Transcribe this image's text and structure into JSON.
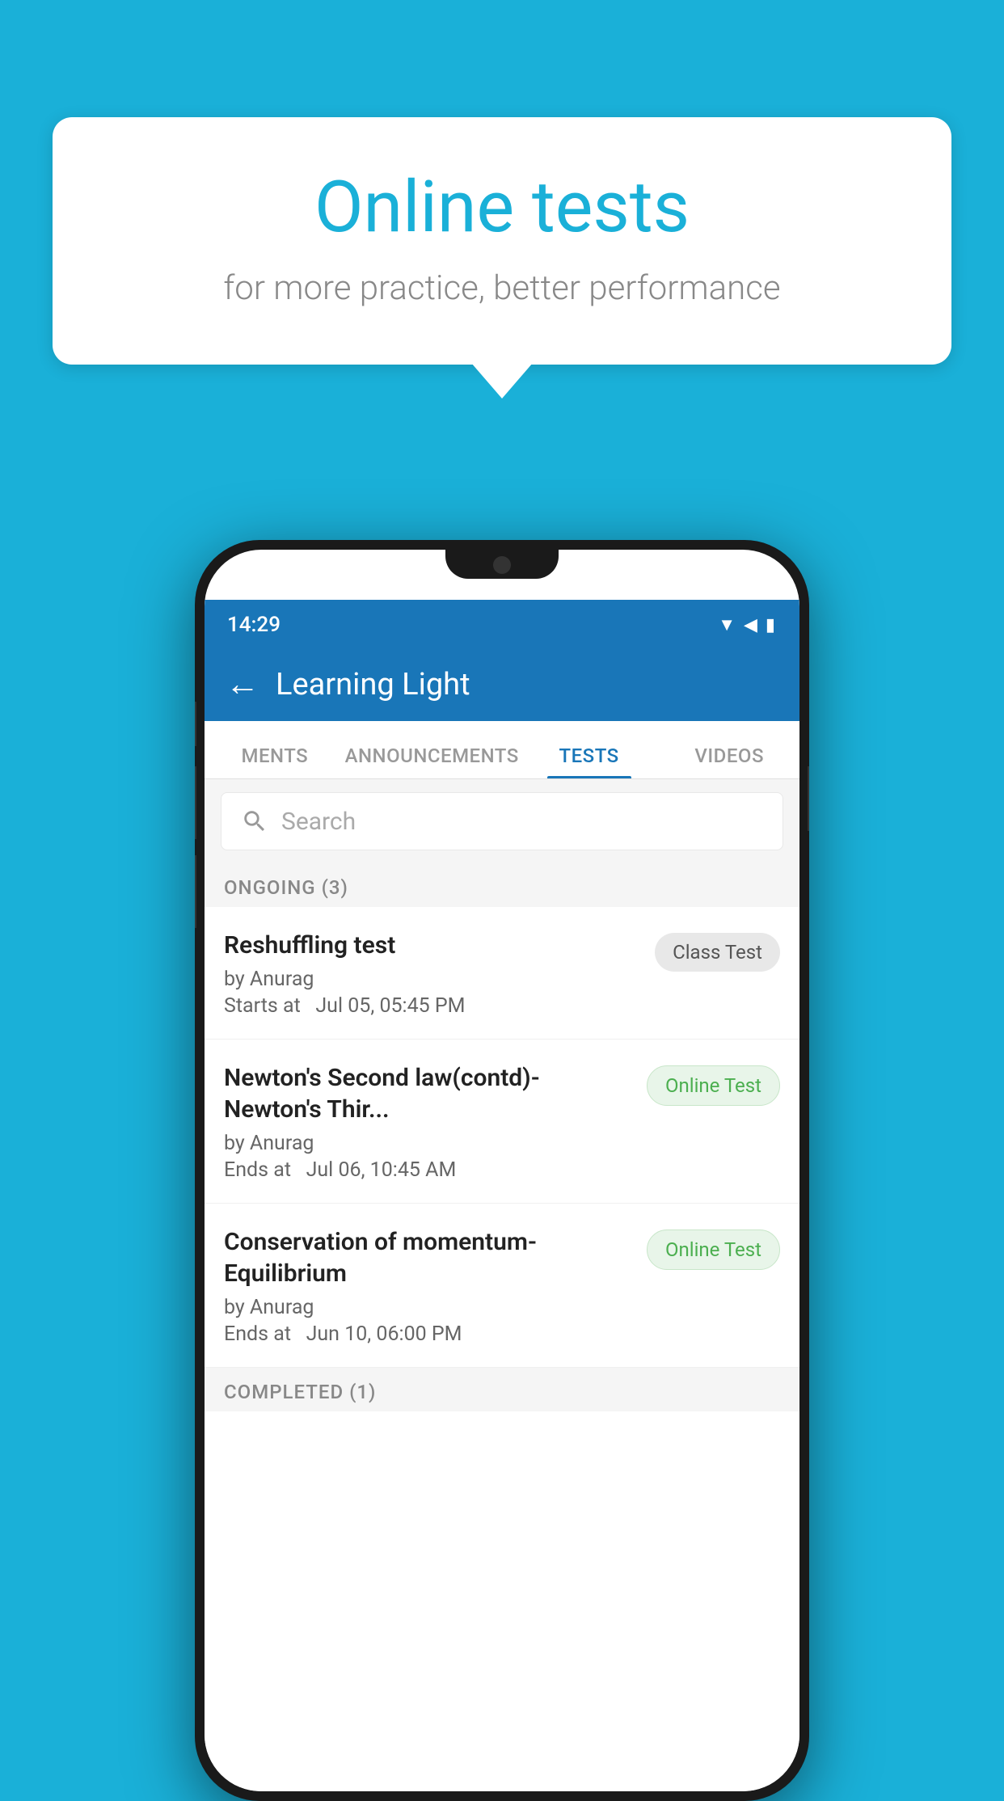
{
  "background": {
    "color": "#1ab0d8"
  },
  "speech_bubble": {
    "title": "Online tests",
    "subtitle": "for more practice, better performance"
  },
  "phone": {
    "status_bar": {
      "time": "14:29",
      "icons": [
        "wifi",
        "signal",
        "battery"
      ]
    },
    "header": {
      "back_label": "←",
      "title": "Learning Light"
    },
    "tabs": [
      {
        "label": "MENTS",
        "active": false
      },
      {
        "label": "ANNOUNCEMENTS",
        "active": false
      },
      {
        "label": "TESTS",
        "active": true
      },
      {
        "label": "VIDEOS",
        "active": false
      }
    ],
    "search": {
      "placeholder": "Search"
    },
    "sections": [
      {
        "header": "ONGOING (3)",
        "items": [
          {
            "name": "Reshuffling test",
            "author": "by Anurag",
            "time_label": "Starts at",
            "time": "Jul 05, 05:45 PM",
            "badge": "Class Test",
            "badge_type": "class"
          },
          {
            "name": "Newton's Second law(contd)-Newton's Thir...",
            "author": "by Anurag",
            "time_label": "Ends at",
            "time": "Jul 06, 10:45 AM",
            "badge": "Online Test",
            "badge_type": "online"
          },
          {
            "name": "Conservation of momentum-Equilibrium",
            "author": "by Anurag",
            "time_label": "Ends at",
            "time": "Jun 10, 06:00 PM",
            "badge": "Online Test",
            "badge_type": "online"
          }
        ]
      },
      {
        "header": "COMPLETED (1)",
        "items": []
      }
    ]
  }
}
